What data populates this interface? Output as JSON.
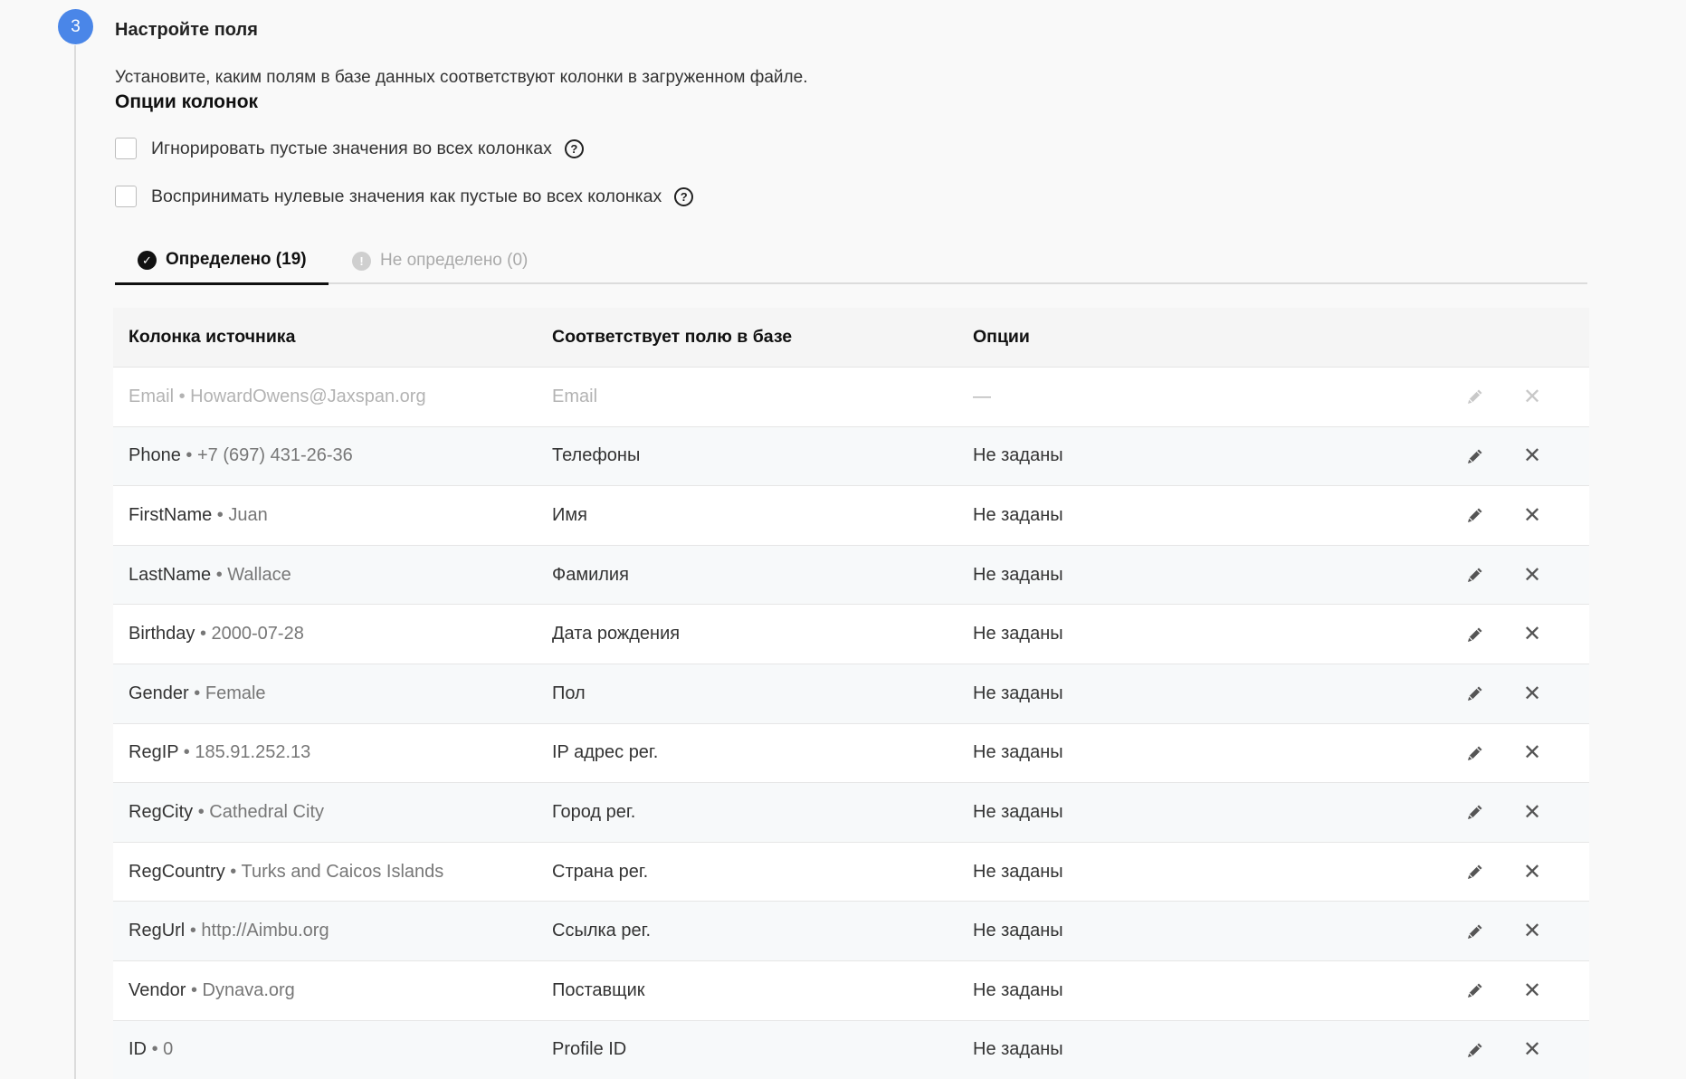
{
  "step": {
    "number": "3",
    "title": "Настройте поля",
    "description": "Установите, каким полям в базе данных соответствуют колонки в загруженном файле."
  },
  "column_options": {
    "title": "Опции колонок",
    "options": [
      {
        "label": "Игнорировать пустые значения во всех колонках",
        "checked": false
      },
      {
        "label": "Воспринимать нулевые значения как пустые во всех колонках",
        "checked": false
      }
    ]
  },
  "tabs": [
    {
      "label": "Определено (19)",
      "icon": "check-icon",
      "active": true
    },
    {
      "label": "Не определено (0)",
      "icon": "exclamation-icon",
      "active": false
    }
  ],
  "table": {
    "headers": {
      "source": "Колонка источника",
      "field": "Соответствует полю в базе",
      "options": "Опции"
    },
    "separator": "•",
    "rows": [
      {
        "source": "Email",
        "sample": "HowardOwens@Jaxspan.org",
        "field": "Email",
        "options": "—",
        "disabled": true
      },
      {
        "source": "Phone",
        "sample": "+7 (697) 431-26-36",
        "field": "Телефоны",
        "options": "Не заданы",
        "disabled": false
      },
      {
        "source": "FirstName",
        "sample": "Juan",
        "field": "Имя",
        "options": "Не заданы",
        "disabled": false
      },
      {
        "source": "LastName",
        "sample": "Wallace",
        "field": "Фамилия",
        "options": "Не заданы",
        "disabled": false
      },
      {
        "source": "Birthday",
        "sample": "2000-07-28",
        "field": "Дата рождения",
        "options": "Не заданы",
        "disabled": false
      },
      {
        "source": "Gender",
        "sample": "Female",
        "field": "Пол",
        "options": "Не заданы",
        "disabled": false
      },
      {
        "source": "RegIP",
        "sample": "185.91.252.13",
        "field": "IP адрес рег.",
        "options": "Не заданы",
        "disabled": false
      },
      {
        "source": "RegCity",
        "sample": "Cathedral City",
        "field": "Город рег.",
        "options": "Не заданы",
        "disabled": false
      },
      {
        "source": "RegCountry",
        "sample": "Turks and Caicos Islands",
        "field": "Страна рег.",
        "options": "Не заданы",
        "disabled": false
      },
      {
        "source": "RegUrl",
        "sample": "http://Aimbu.org",
        "field": "Ссылка рег.",
        "options": "Не заданы",
        "disabled": false
      },
      {
        "source": "Vendor",
        "sample": "Dynava.org",
        "field": "Поставщик",
        "options": "Не заданы",
        "disabled": false
      },
      {
        "source": "ID",
        "sample": "0",
        "field": "Profile ID",
        "options": "Не заданы",
        "disabled": false
      }
    ]
  },
  "colors": {
    "accent": "#4a86e8",
    "text": "#333333",
    "muted": "#777777",
    "disabled": "#b3b3b3"
  }
}
